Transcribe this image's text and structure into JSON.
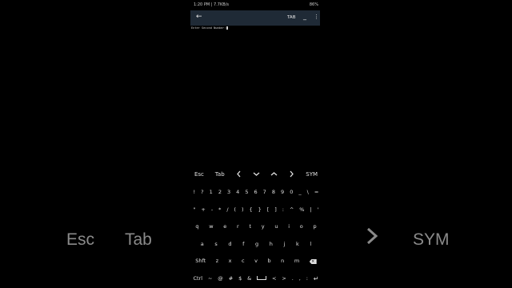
{
  "status": {
    "time": "1:20 PM",
    "speed": "7.7KB/s",
    "battery": "86%"
  },
  "appbar": {
    "tab_label": "TAB",
    "minimize_label": "_"
  },
  "terminal": {
    "prompt": "Enter Second Number:"
  },
  "extra_keys": {
    "esc": "Esc",
    "tab": "Tab",
    "sym": "SYM"
  },
  "keyboard": {
    "row1": [
      "!",
      "?",
      "1",
      "2",
      "3",
      "4",
      "5",
      "6",
      "7",
      "8",
      "9",
      "0",
      "_",
      "\\",
      "="
    ],
    "row2": [
      "\"",
      "+",
      "-",
      "*",
      "/",
      "(",
      ")",
      "{",
      "}",
      "[",
      "]",
      ":",
      "^",
      "%",
      "|",
      "'"
    ],
    "row3": [
      "q",
      "w",
      "e",
      "r",
      "t",
      "y",
      "u",
      "i",
      "o",
      "p"
    ],
    "row4": [
      "a",
      "s",
      "d",
      "f",
      "g",
      "h",
      "j",
      "k",
      "l"
    ],
    "row5": [
      "Shft",
      "z",
      "x",
      "c",
      "v",
      "b",
      "n",
      "m"
    ],
    "row6": [
      "Ctrl",
      "~",
      "@",
      "#",
      "$",
      "&",
      "<",
      ">",
      ".",
      ",",
      ":"
    ]
  },
  "ghost": {
    "esc": "Esc",
    "tab": "Tab",
    "sym": "SYM"
  }
}
